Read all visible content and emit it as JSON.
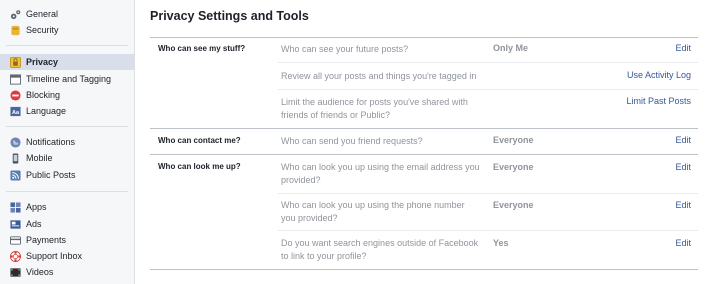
{
  "sidebar": {
    "items": [
      {
        "label": "General",
        "icon": "gear-icon"
      },
      {
        "label": "Security",
        "icon": "shield-icon"
      },
      {
        "label": "Privacy",
        "icon": "lock-icon",
        "active": true
      },
      {
        "label": "Timeline and Tagging",
        "icon": "timeline-icon"
      },
      {
        "label": "Blocking",
        "icon": "block-icon"
      },
      {
        "label": "Language",
        "icon": "language-icon"
      },
      {
        "label": "Notifications",
        "icon": "globe-icon"
      },
      {
        "label": "Mobile",
        "icon": "mobile-icon"
      },
      {
        "label": "Public Posts",
        "icon": "rss-icon"
      },
      {
        "label": "Apps",
        "icon": "apps-icon"
      },
      {
        "label": "Ads",
        "icon": "ads-icon"
      },
      {
        "label": "Payments",
        "icon": "payments-icon"
      },
      {
        "label": "Support Inbox",
        "icon": "lifebuoy-icon"
      },
      {
        "label": "Videos",
        "icon": "video-icon"
      }
    ]
  },
  "main": {
    "title": "Privacy Settings and Tools",
    "sections": [
      {
        "label": "Who can see my stuff?",
        "rows": [
          {
            "question": "Who can see your future posts?",
            "value": "Only Me",
            "action": "Edit"
          },
          {
            "question": "Review all your posts and things you're tagged in",
            "value": "",
            "action": "Use Activity Log"
          },
          {
            "question": "Limit the audience for posts you've shared with friends of friends or Public?",
            "value": "",
            "action": "Limit Past Posts"
          }
        ]
      },
      {
        "label": "Who can contact me?",
        "rows": [
          {
            "question": "Who can send you friend requests?",
            "value": "Everyone",
            "action": "Edit"
          }
        ]
      },
      {
        "label": "Who can look me up?",
        "rows": [
          {
            "question": "Who can look you up using the email address you provided?",
            "value": "Everyone",
            "action": "Edit"
          },
          {
            "question": "Who can look you up using the phone number you provided?",
            "value": "Everyone",
            "action": "Edit"
          },
          {
            "question": "Do you want search engines outside of Facebook to link to your profile?",
            "value": "Yes",
            "action": "Edit"
          }
        ]
      }
    ]
  },
  "colors": {
    "link": "#365899",
    "muted": "#90949c",
    "active_bg": "#d8dfea"
  }
}
